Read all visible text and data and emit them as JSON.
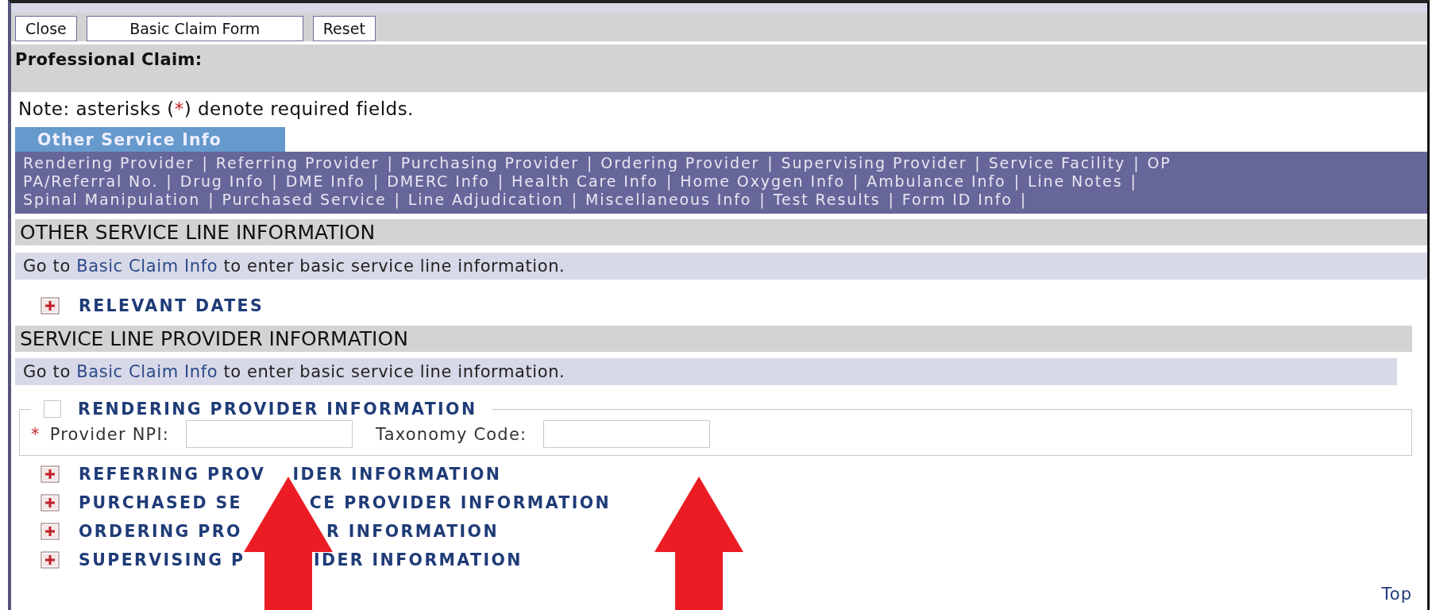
{
  "toolbar": {
    "buttons": [
      "Close",
      "Basic Claim Form",
      "Reset"
    ]
  },
  "page_title": "Professional Claim:",
  "note": {
    "before": "Note: asterisks (",
    "mark": "*",
    "after": ") denote required fields."
  },
  "tabs": [
    {
      "label": "Other Service Info",
      "selected": true
    }
  ],
  "nav": {
    "lines": [
      [
        {
          "label": "Rendering Provider",
          "separator": "|"
        },
        {
          "label": "Referring Provider",
          "separator": "|"
        },
        {
          "label": "Purchasing Provider",
          "separator": "|"
        },
        {
          "label": "Ordering Provider",
          "separator": "|"
        },
        {
          "label": "Supervising Provider",
          "separator": "|"
        },
        {
          "label": "Service Facility",
          "separator": "|"
        },
        {
          "label": "OP"
        }
      ],
      [
        {
          "label": "PA/Referral No.",
          "separator": "|"
        },
        {
          "label": "Drug Info",
          "separator": "|"
        },
        {
          "label": "DME Info",
          "separator": "|"
        },
        {
          "label": "DMERC Info",
          "separator": "|"
        },
        {
          "label": "Health Care Info",
          "separator": "|"
        },
        {
          "label": "Home Oxygen Info",
          "separator": "|"
        },
        {
          "label": "Ambulance Info",
          "separator": "|"
        },
        {
          "label": "Line Notes",
          "separator": "|"
        }
      ],
      [
        {
          "label": "Spinal Manipulation",
          "separator": "|"
        },
        {
          "label": "Purchased Service",
          "separator": "|"
        },
        {
          "label": "Line Adjudication",
          "separator": "|"
        },
        {
          "label": "Miscellaneous Info",
          "separator": "|"
        },
        {
          "label": "Test Results",
          "separator": "|"
        },
        {
          "label": "Form ID Info",
          "separator": "|"
        }
      ]
    ]
  },
  "sections": [
    {
      "heading": "OTHER SERVICE LINE INFORMATION",
      "info": {
        "before": "Go to ",
        "link": "Basic Claim Info",
        "after": " to enter basic service line information."
      },
      "groups": [
        {
          "kind": "collapsible",
          "title_parts": [
            "RELEVANT DATES"
          ],
          "expanded": false
        }
      ]
    },
    {
      "heading": "SERVICE LINE PROVIDER INFORMATION",
      "info": {
        "before": "Go to ",
        "link": "Basic Claim Info",
        "after": " to enter basic service line information."
      },
      "groups": [
        {
          "kind": "fieldset",
          "title": "RENDERING PROVIDER INFORMATION",
          "checked": false,
          "fields": [
            {
              "label": "Provider NPI:",
              "required": true,
              "required_mark": "*"
            },
            {
              "label": "Taxonomy Code:",
              "required": false
            }
          ]
        },
        {
          "kind": "collapsible",
          "title_parts": [
            "REFERRING PROV",
            "IDER INFORMATION"
          ],
          "expanded": false
        },
        {
          "kind": "collapsible",
          "title_parts": [
            "PURCHASED SE",
            "CE PROVIDER INFORMATION"
          ],
          "expanded": false
        },
        {
          "kind": "collapsible",
          "title_parts": [
            "ORDERING PRO",
            "R INFORMATION"
          ],
          "expanded": false
        },
        {
          "kind": "collapsible",
          "title_parts": [
            "SUPERVISING P",
            "IDER INFORMATION"
          ],
          "expanded": false
        }
      ]
    }
  ],
  "top_link": "Top"
}
